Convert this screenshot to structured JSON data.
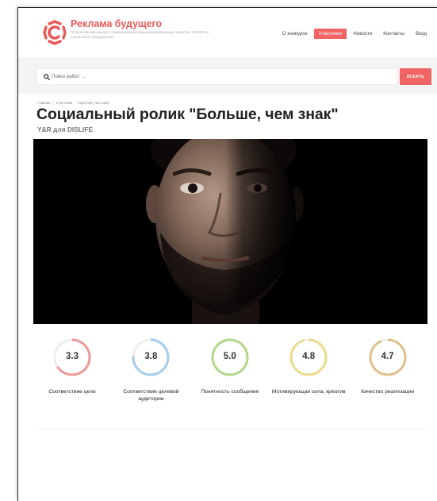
{
  "brand": {
    "name": "Реклама будущего",
    "tagline": "Всероссийский конкурс социальной рекламы некоммерческих проектов, ОО/НКО и социальных предприятий",
    "accent_color": "#f06464"
  },
  "nav": {
    "items": [
      {
        "label": "О конкурсе",
        "active": false
      },
      {
        "label": "Участники",
        "active": true
      },
      {
        "label": "Новости",
        "active": false
      },
      {
        "label": "Контакты",
        "active": false
      },
      {
        "label": "Вход",
        "active": false
      }
    ]
  },
  "search": {
    "placeholder": "Поиск работ ...",
    "button_label": "ИСКАТЬ",
    "icon": "search-icon"
  },
  "breadcrumb": {
    "items": [
      "Главная",
      "Участники",
      "Карточка участника"
    ],
    "separator": "/"
  },
  "work": {
    "title": "Социальный ролик \"Больше, чем знак\"",
    "subtitle": "Y&R для DISLIFE"
  },
  "video": {
    "content": "close-up portrait of a bearded man on black background, half-lit face"
  },
  "scores": [
    {
      "value": "3.3",
      "rating": 3.3,
      "max": 5,
      "label": "Соответствие цели",
      "color": "#ee9a9a"
    },
    {
      "value": "3.8",
      "rating": 3.8,
      "max": 5,
      "label": "Соответствие целевой аудитории",
      "color": "#a6cdea"
    },
    {
      "value": "5.0",
      "rating": 5.0,
      "max": 5,
      "label": "Понятность сообщения",
      "color": "#b3d88c"
    },
    {
      "value": "4.8",
      "rating": 4.8,
      "max": 5,
      "label": "Мотивирующая сила, креатив",
      "color": "#e9dc8a"
    },
    {
      "value": "4.7",
      "rating": 4.7,
      "max": 5,
      "label": "Качество реализации",
      "color": "#e0c08a"
    }
  ]
}
